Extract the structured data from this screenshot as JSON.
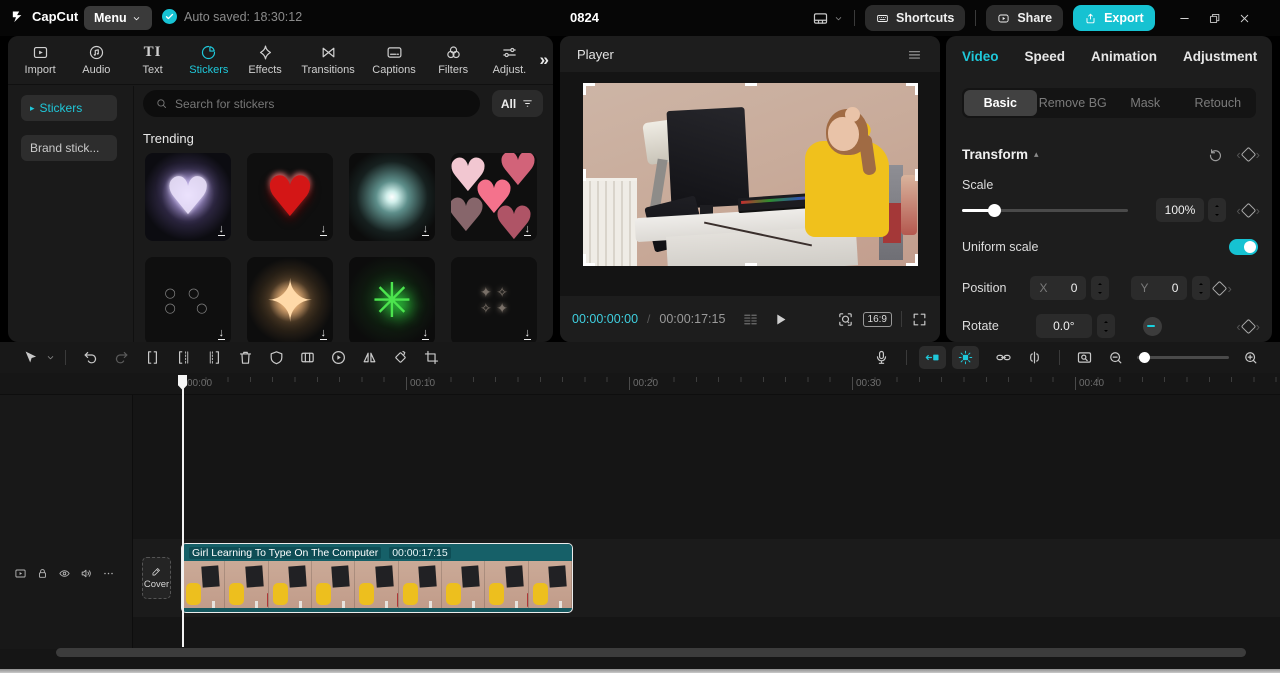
{
  "colors": {
    "accent": "#1fc8da",
    "export_button": "#16c2d2",
    "clip_teal": "#15585f",
    "timecode_active": "#3fcfdf"
  },
  "topbar": {
    "logo_text": "CapCut",
    "menu_label": "Menu",
    "autosave_text": "Auto saved: 18:30:12",
    "project_title": "0824",
    "shortcuts_label": "Shortcuts",
    "share_label": "Share",
    "export_label": "Export"
  },
  "left_toolbar": {
    "items": [
      {
        "name": "import",
        "label": "Import"
      },
      {
        "name": "audio",
        "label": "Audio"
      },
      {
        "name": "text",
        "label": "Text",
        "glyph": "TI"
      },
      {
        "name": "stickers",
        "label": "Stickers",
        "active": true
      },
      {
        "name": "effects",
        "label": "Effects"
      },
      {
        "name": "transitions",
        "label": "Transitions"
      },
      {
        "name": "captions",
        "label": "Captions"
      },
      {
        "name": "filters",
        "label": "Filters"
      },
      {
        "name": "adjust",
        "label": "Adjust."
      }
    ],
    "more_glyph": "»"
  },
  "sticker_panel": {
    "sidebar_items": [
      {
        "label": "Stickers",
        "marker": "▸",
        "active": true
      },
      {
        "label": "Brand stick..."
      }
    ],
    "search_placeholder": "Search for stickers",
    "filter_label": "All",
    "section_title": "Trending",
    "sticker_names": [
      "sparkling-heart-firework",
      "red-glossy-heart",
      "white-teal-starburst",
      "pink-hearts-cluster",
      "dark-bubbles",
      "golden-lens-flare",
      "green-firework-burst",
      "dim-sparkle-stars"
    ]
  },
  "player": {
    "title": "Player",
    "current_time": "00:00:00:00",
    "time_separator": "/",
    "duration": "00:00:17:15",
    "ratio_label": "16:9"
  },
  "inspector": {
    "tabs": [
      {
        "label": "Video",
        "active": true
      },
      {
        "label": "Speed"
      },
      {
        "label": "Animation"
      },
      {
        "label": "Adjustment"
      }
    ],
    "subtabs": [
      {
        "label": "Basic",
        "active": true
      },
      {
        "label": "Remove BG"
      },
      {
        "label": "Mask"
      },
      {
        "label": "Retouch"
      }
    ],
    "transform": {
      "title": "Transform",
      "collapse_glyph": "▴",
      "scale_label": "Scale",
      "scale_value": "100%",
      "uniform_label": "Uniform scale",
      "uniform_on": true,
      "position_label": "Position",
      "x_label": "X",
      "x_value": "0",
      "y_label": "Y",
      "y_value": "0",
      "rotate_label": "Rotate",
      "rotate_value": "0.0°",
      "keyframe_prev": "‹",
      "keyframe_next": "›"
    }
  },
  "timeline": {
    "left_tool_names": [
      "select-tool",
      "tool-caret",
      "undo",
      "redo",
      "split",
      "split-keep-left",
      "split-keep-right",
      "delete",
      "mask",
      "overlay",
      "freeze-frame",
      "mirror",
      "rotate",
      "crop"
    ],
    "right_tool_names": [
      "record-voiceover",
      "auto-snap",
      "preview-frames",
      "link",
      "unlink",
      "thumbnail-preview",
      "zoom-out",
      "zoom-slider",
      "zoom-in"
    ],
    "ruler_labels": [
      "00:00",
      "00:10",
      "00:20",
      "00:30",
      "00:40"
    ],
    "cover_label": "Cover",
    "clip": {
      "title": "Girl Learning To Type On The Computer",
      "duration": "00:00:17:15"
    }
  }
}
